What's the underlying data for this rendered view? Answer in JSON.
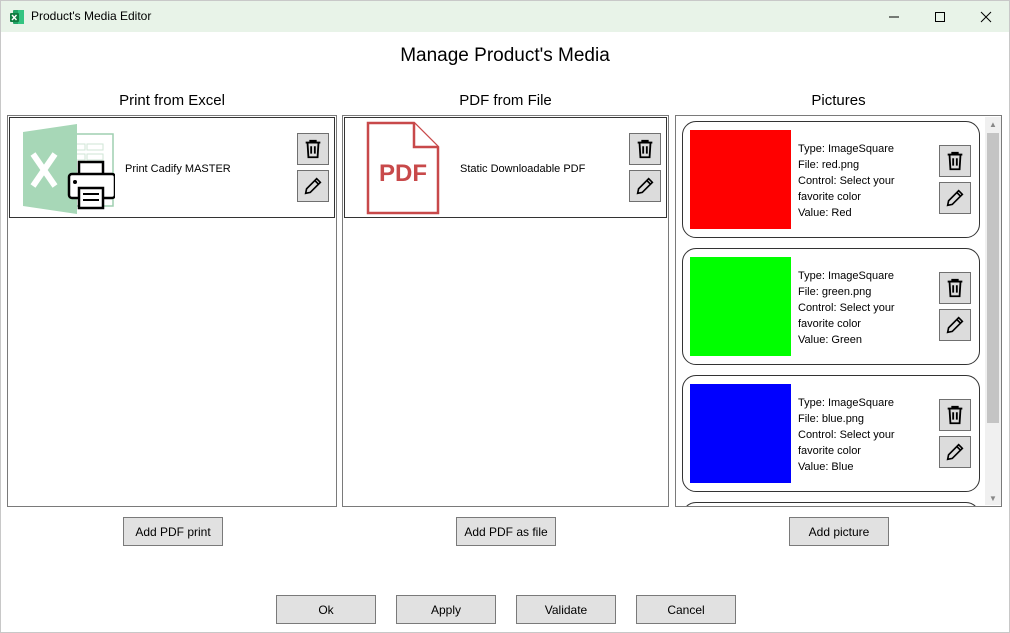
{
  "window": {
    "title": "Product's Media Editor",
    "app_icon": "excel-icon",
    "controls": [
      "minimize-icon",
      "maximize-icon",
      "close-icon"
    ]
  },
  "heading": "Manage Product's Media",
  "columns": {
    "excel": {
      "title": "Print from Excel",
      "items": [
        {
          "label": "Print Cadify MASTER",
          "icon": "excel-print-icon"
        }
      ],
      "add_button": "Add PDF print"
    },
    "pdf": {
      "title": "PDF from File",
      "items": [
        {
          "label": "Static Downloadable PDF",
          "icon": "pdf-file-icon",
          "icon_text": "PDF"
        }
      ],
      "add_button": "Add PDF as file"
    },
    "pictures": {
      "title": "Pictures",
      "items": [
        {
          "type": "Type: ImageSquare",
          "file": "File: red.png",
          "control": "Control: Select your favorite color",
          "value": "Value: Red",
          "color": "#ff0000"
        },
        {
          "type": "Type: ImageSquare",
          "file": "File: green.png",
          "control": "Control: Select your favorite color",
          "value": "Value: Green",
          "color": "#00ff00"
        },
        {
          "type": "Type: ImageSquare",
          "file": "File: blue.png",
          "control": "Control: Select your favorite color",
          "value": "Value: Blue",
          "color": "#0000ff"
        }
      ],
      "add_button": "Add picture"
    }
  },
  "footer": {
    "ok": "Ok",
    "apply": "Apply",
    "validate": "Validate",
    "cancel": "Cancel"
  },
  "icons": {
    "delete": "trash-icon",
    "edit": "pencil-icon"
  },
  "colors": {
    "titlebar": "#e8f3e8",
    "excel_green": "#1d6f42",
    "pdf_red": "#c8494a",
    "button_bg": "#e1e1e1"
  }
}
